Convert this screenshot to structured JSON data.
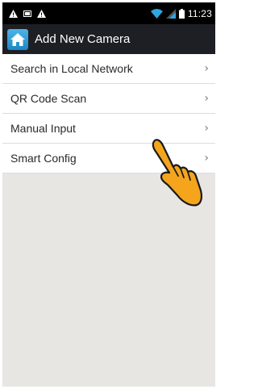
{
  "status_bar": {
    "time": "11:23",
    "left_icons": [
      "warning-icon",
      "sim-icon",
      "warning-icon"
    ],
    "right_icons": [
      "wifi-icon",
      "signal-icon",
      "battery-icon"
    ]
  },
  "action_bar": {
    "title": "Add New Camera",
    "icon": "home-icon"
  },
  "menu": {
    "items": [
      {
        "label": "Search in Local Network",
        "icon": "chevron-right-icon"
      },
      {
        "label": "QR Code Scan",
        "icon": "chevron-right-icon"
      },
      {
        "label": "Manual Input",
        "icon": "chevron-right-icon"
      },
      {
        "label": "Smart Config",
        "icon": "chevron-right-icon"
      }
    ],
    "chevron": "›"
  },
  "colors": {
    "status_bar": "#000000",
    "action_bar": "#1d1f24",
    "background": "#e8e6e3",
    "hand_fill": "#f4a51c",
    "wifi": "#2ea7e0"
  }
}
